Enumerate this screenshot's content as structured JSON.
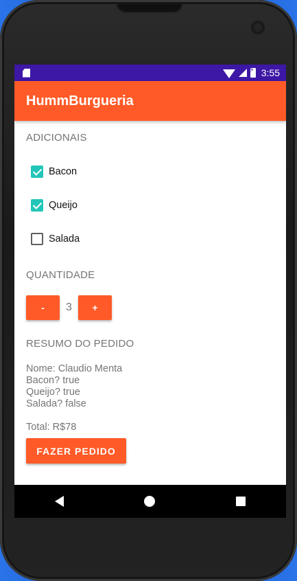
{
  "statusbar": {
    "time": "3:55"
  },
  "app": {
    "title": "HummBurgueria"
  },
  "adicionais": {
    "label": "ADICIONAIS",
    "items": [
      {
        "label": "Bacon",
        "checked": true
      },
      {
        "label": "Queijo",
        "checked": true
      },
      {
        "label": "Salada",
        "checked": false
      }
    ]
  },
  "quantidade": {
    "label": "QUANTIDADE",
    "minus": "-",
    "value": "3",
    "plus": "+"
  },
  "resumo": {
    "label": "RESUMO DO PEDIDO",
    "lines": [
      "Nome: Claudio Menta",
      "Bacon? true",
      "Queijo? true",
      "Salada? false"
    ],
    "total": "Total: R$78"
  },
  "order_button": "FAZER PEDIDO",
  "colors": {
    "primary": "#ff5a27",
    "status_bar": "#3d17a6",
    "accent": "#21c6b8"
  }
}
